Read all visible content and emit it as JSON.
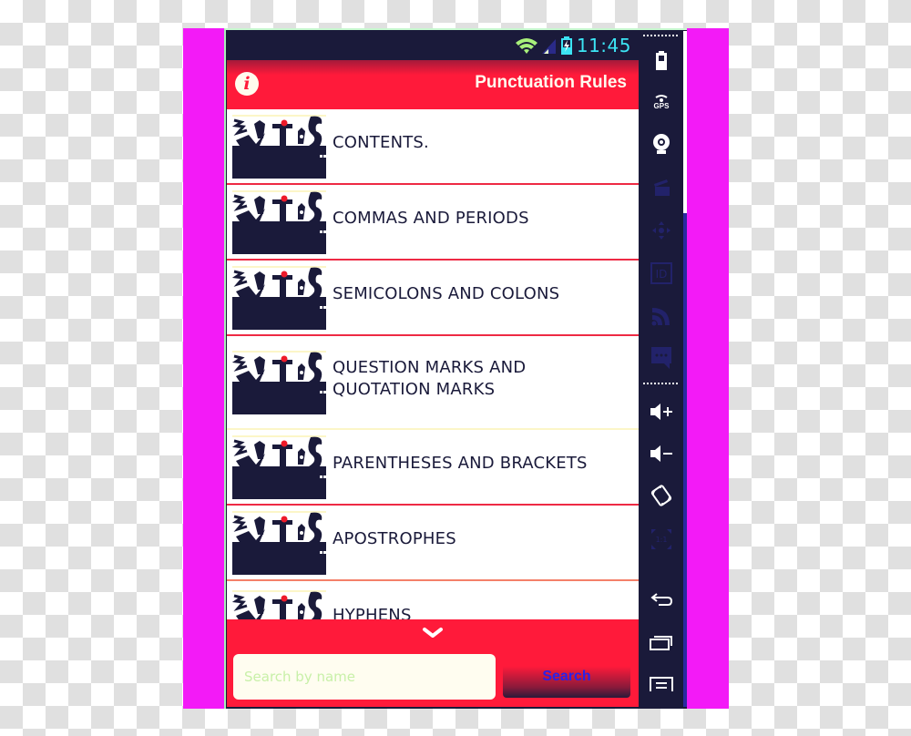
{
  "status_bar": {
    "time": "11:45",
    "icons": [
      "wifi-icon",
      "signal-icon",
      "battery-charging-icon"
    ]
  },
  "action_bar": {
    "info_icon": "info-icon",
    "info_glyph": "i",
    "title": "Punctuation Rules"
  },
  "list": {
    "items": [
      {
        "label": "CONTENTS."
      },
      {
        "label": "COMMAS AND PERIODS"
      },
      {
        "label": "SEMICOLONS AND COLONS"
      },
      {
        "label": "QUESTION MARKS AND QUOTATION MARKS"
      },
      {
        "label": "PARENTHESES AND BRACKETS"
      },
      {
        "label": "APOSTROPHES"
      },
      {
        "label": "HYPHENS"
      }
    ]
  },
  "bottom_panel": {
    "expand_icon": "chevron-down-icon",
    "search": {
      "placeholder": "Search by name",
      "value": ""
    },
    "search_button_label": "Search"
  },
  "nav_rail": {
    "items": [
      {
        "name": "battery-icon",
        "enabled": true
      },
      {
        "name": "gps-icon",
        "label": "GPS",
        "enabled": true
      },
      {
        "name": "webcam-icon",
        "enabled": true
      },
      {
        "name": "clapperboard-icon",
        "enabled": false
      },
      {
        "name": "dpad-icon",
        "enabled": false
      },
      {
        "name": "id-icon",
        "label": "ID",
        "enabled": false
      },
      {
        "name": "rss-icon",
        "enabled": false
      },
      {
        "name": "chat-icon",
        "enabled": false
      },
      {
        "name": "volume-up-icon",
        "enabled": true
      },
      {
        "name": "volume-down-icon",
        "enabled": true
      },
      {
        "name": "rotate-icon",
        "enabled": true
      },
      {
        "name": "scale-icon",
        "label": "1:1",
        "enabled": false
      },
      {
        "name": "back-icon",
        "enabled": true
      },
      {
        "name": "recent-apps-icon",
        "enabled": true
      },
      {
        "name": "menu-icon",
        "enabled": true
      }
    ]
  },
  "colors": {
    "accent_red": "#ff1a3a",
    "dark_navy": "#1a1a3a",
    "time_cyan": "#3ce4f4",
    "frame_magenta": "#f31af7",
    "search_button_text": "#2a22e8"
  }
}
